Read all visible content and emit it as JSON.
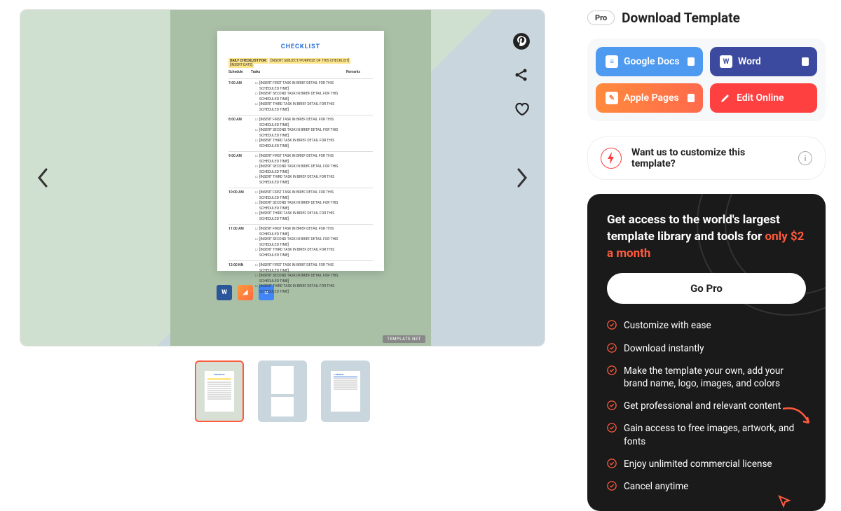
{
  "header": {
    "pro_badge": "Pro",
    "title": "Download Template"
  },
  "downloads": {
    "gdocs": "Google Docs",
    "word": "Word",
    "pages": "Apple Pages",
    "edit": "Edit Online"
  },
  "customize": {
    "text": "Want us to customize this template?"
  },
  "document": {
    "title": "CHECKLIST",
    "subtitle_prefix": "DAILY CHECKLIST FOR:",
    "subtitle_placeholder": "[INSERT SUBJECT/PURPOSE OF THIS CHECKLIST]",
    "date_placeholder": "[INSERT DATE]",
    "col_schedule": "Schedule",
    "col_tasks": "Tasks",
    "col_remarks": "Remarks",
    "times": [
      "7:00 AM",
      "8:00 AM",
      "9:00 AM",
      "10:00 AM",
      "11:00 AM",
      "12:00 NN"
    ],
    "task1": "[INSERT FIRST TASK IN BRIEF DETAIL FOR THIS SCHEDULED TIME]",
    "task2": "[INSERT SECOND TASK IN BRIEF DETAIL FOR THIS SCHEDULED TIME]",
    "task3": "[INSERT THIRD TASK IN BRIEF DETAIL FOR THIS SCHEDULED TIME]",
    "watermark": "TEMPLATE.NET"
  },
  "pro_card": {
    "heading_a": "Get access to the world's largest template library and tools for ",
    "heading_b": "only $2 a month",
    "go_pro": "Go Pro",
    "features": [
      "Customize with ease",
      "Download instantly",
      "Make the template your own, add your brand name, logo, images, and colors",
      "Get professional and relevant content",
      "Gain access to free images, artwork, and fonts",
      "Enjoy unlimited commercial license",
      "Cancel anytime"
    ]
  }
}
